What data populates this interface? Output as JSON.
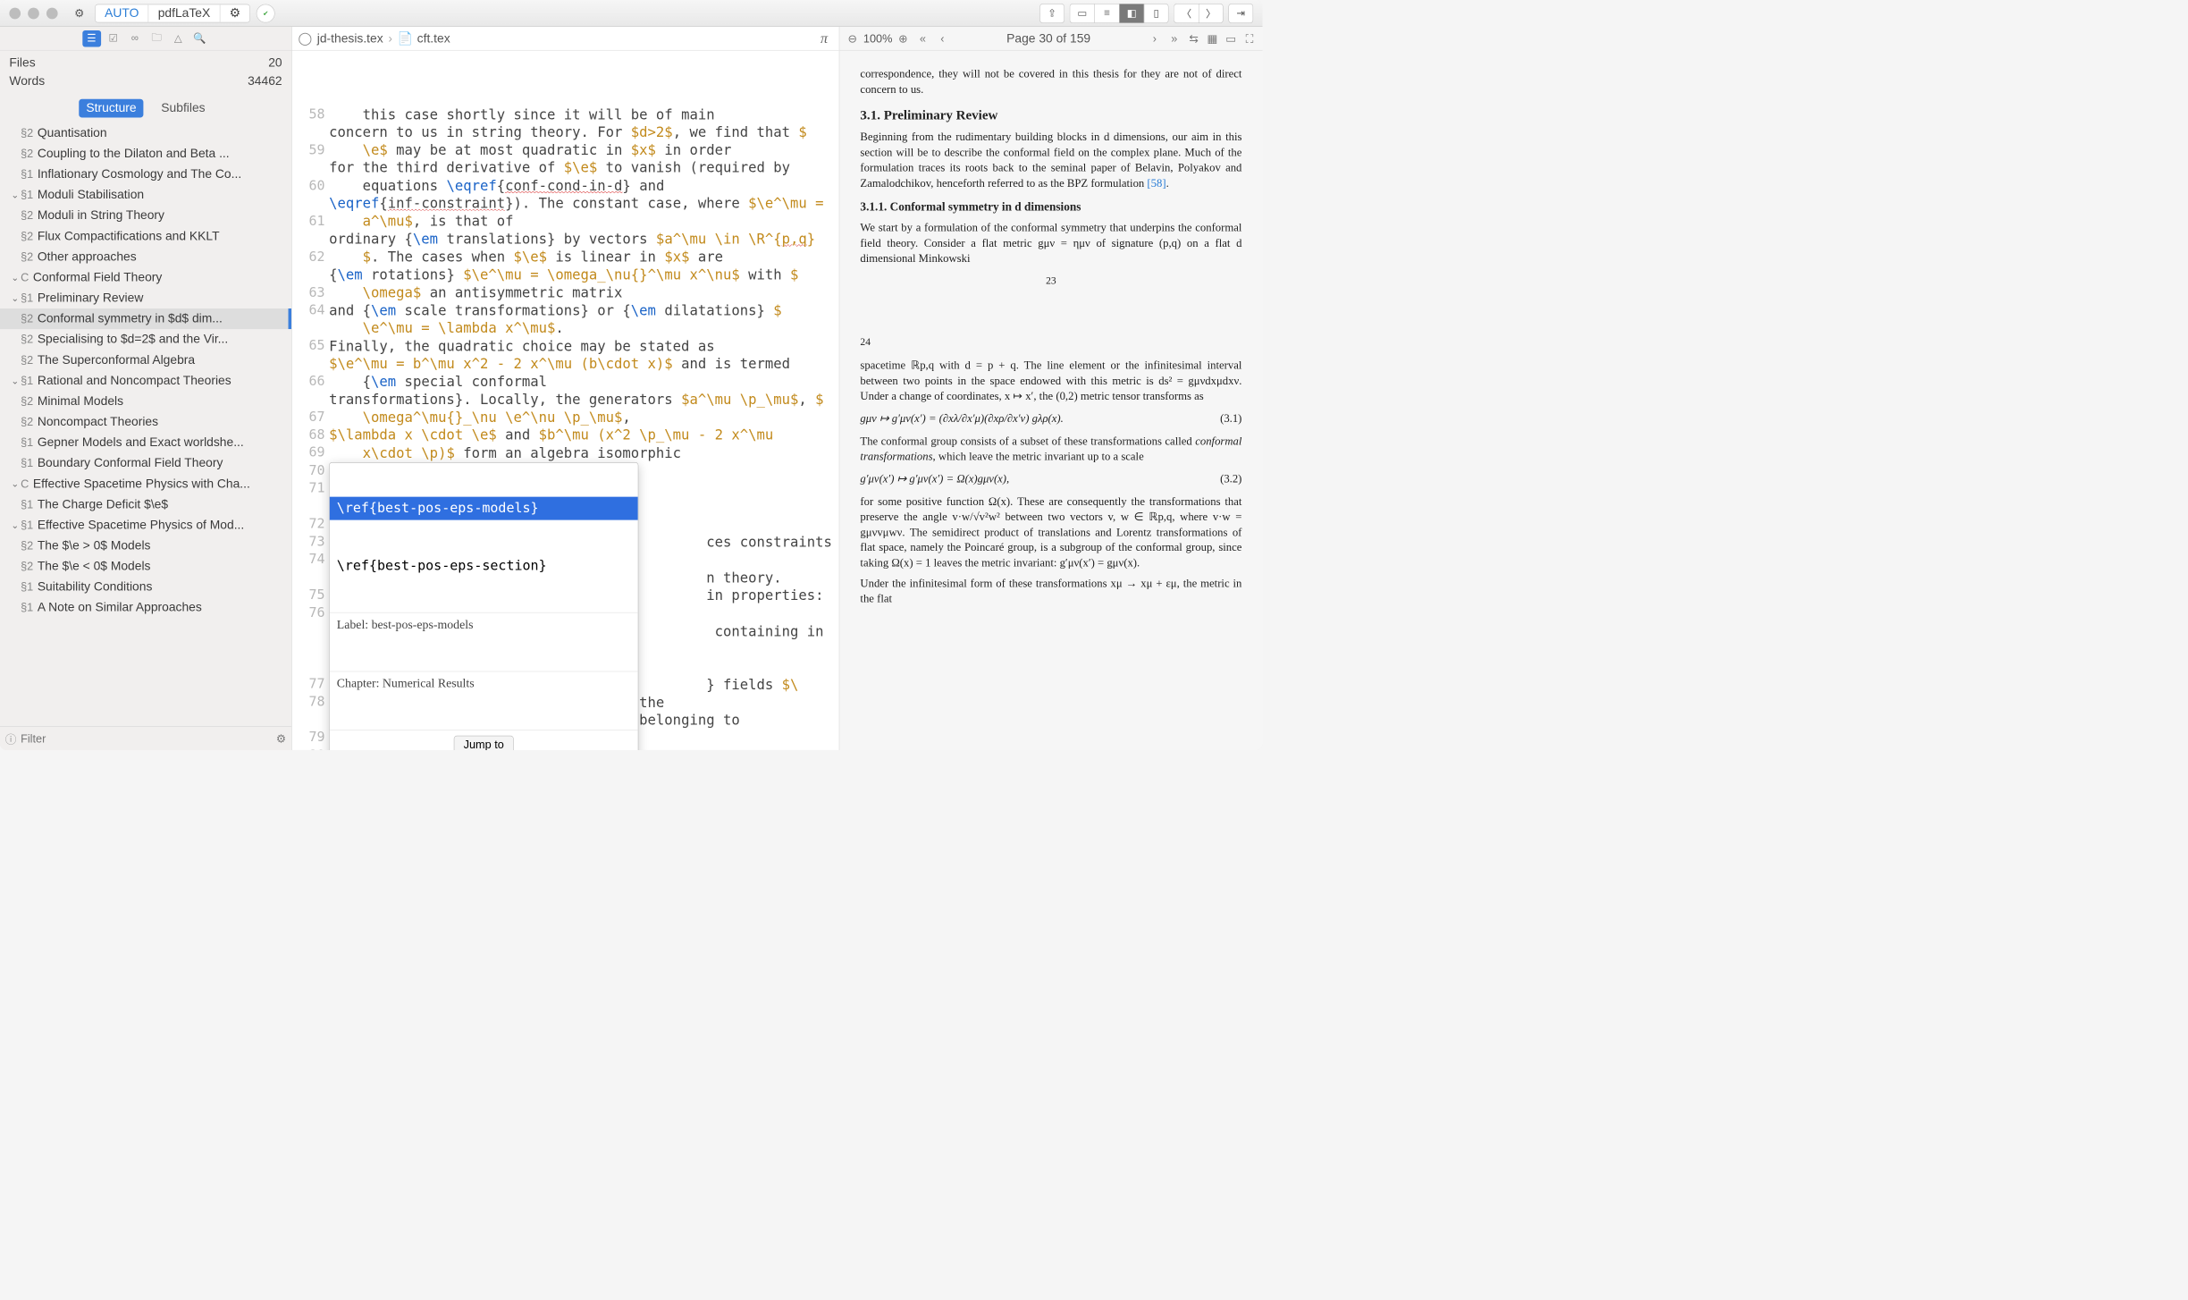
{
  "toolbar": {
    "auto": "AUTO",
    "engine": "pdfLaTeX"
  },
  "sidebar": {
    "stats": {
      "files_label": "Files",
      "files": "20",
      "words_label": "Words",
      "words": "34462"
    },
    "tabs": {
      "structure": "Structure",
      "subfiles": "Subfiles"
    },
    "items": [
      {
        "num": "§2",
        "label": "Quantisation",
        "indent": 2
      },
      {
        "num": "§2",
        "label": "Coupling to the Dilaton and Beta ...",
        "indent": 1
      },
      {
        "num": "§1",
        "label": "Inflationary Cosmology and The Co...",
        "indent": 1
      },
      {
        "num": "§1",
        "label": "Moduli Stabilisation",
        "indent": 1,
        "disclose": true
      },
      {
        "num": "§2",
        "label": "Moduli in String Theory",
        "indent": 2
      },
      {
        "num": "§2",
        "label": "Flux Compactifications and KKLT",
        "indent": 2
      },
      {
        "num": "§2",
        "label": "Other approaches",
        "indent": 2
      },
      {
        "num": "C",
        "label": "Conformal Field Theory",
        "indent": 0,
        "disclose": true
      },
      {
        "num": "§1",
        "label": "Preliminary Review",
        "indent": 1,
        "disclose": true
      },
      {
        "num": "§2",
        "label": "Conformal symmetry in $d$ dim...",
        "indent": 2,
        "selected": true
      },
      {
        "num": "§2",
        "label": "Specialising to $d=2$ and the Vir...",
        "indent": 2
      },
      {
        "num": "§2",
        "label": "The Superconformal Algebra",
        "indent": 2
      },
      {
        "num": "§1",
        "label": "Rational and Noncompact Theories",
        "indent": 1,
        "disclose": true
      },
      {
        "num": "§2",
        "label": "Minimal Models",
        "indent": 2
      },
      {
        "num": "§2",
        "label": "Noncompact Theories",
        "indent": 2
      },
      {
        "num": "§1",
        "label": "Gepner Models and Exact worldshe...",
        "indent": 1
      },
      {
        "num": "§1",
        "label": "Boundary Conformal Field Theory",
        "indent": 1
      },
      {
        "num": "C",
        "label": "Effective Spacetime Physics with Cha...",
        "indent": 0,
        "disclose": true
      },
      {
        "num": "§1",
        "label": "The Charge Deficit $\\e$",
        "indent": 1
      },
      {
        "num": "§1",
        "label": "Effective Spacetime Physics of Mod...",
        "indent": 1,
        "disclose": true
      },
      {
        "num": "§2",
        "label": "The $\\e > 0$ Models",
        "indent": 2
      },
      {
        "num": "§2",
        "label": "The $\\e < 0$ Models",
        "indent": 2
      },
      {
        "num": "§1",
        "label": "Suitability Conditions",
        "indent": 1
      },
      {
        "num": "§1",
        "label": "A Note on Similar Approaches",
        "indent": 1
      }
    ],
    "filter_placeholder": "Filter"
  },
  "editor": {
    "breadcrumb": {
      "file1": "jd-thesis.tex",
      "file2": "cft.tex"
    },
    "popup": {
      "opt1": "\\ref{best-pos-eps-models}",
      "opt2": "\\ref{best-pos-eps-section}",
      "label": "Label: best-pos-eps-models",
      "chapter": "Chapter: Numerical Results",
      "jump": "Jump to"
    }
  },
  "preview": {
    "zoom": "100%",
    "page_label": "Page 30 of 159",
    "intro": "correspondence, they will not be covered in this thesis for they are not of direct concern to us.",
    "h_prelim": "3.1.  Preliminary Review",
    "p_prelim": "Beginning from the rudimentary building blocks in d dimensions, our aim in this section will be to describe the conformal field on the complex plane. Much of the formulation traces its roots back to the seminal paper of Belavin, Polyakov and Zamalodchikov, henceforth referred to as the BPZ formulation ",
    "cite58": "[58]",
    "h_conf": "3.1.1.  Conformal symmetry in d dimensions",
    "p_conf1": "We start by a formulation of the conformal symmetry that underpins the conformal field theory. Consider a flat metric gμν = ημν of signature (p,q) on a flat d dimensional Minkowski",
    "pg23": "23",
    "pg24": "24",
    "p_conf2": "spacetime ℝp,q with d = p + q. The line element or the infinitesimal interval between two points in the space endowed with this metric is ds² = gμνdxμdxν. Under a change of coordinates, x ↦ x′, the (0,2) metric tensor transforms as",
    "eq31": "gμν ↦ g′μν(x′) = (∂xλ/∂x′μ)(∂xρ/∂x′ν) gλρ(x).",
    "eq31n": "(3.1)",
    "p_conf3_a": "The conformal group consists of a subset of these transformations called ",
    "p_conf3_b": "conformal transformations",
    "p_conf3_c": ", which leave the metric invariant up to a scale",
    "eq32": "g′μν(x′) ↦ g′μν(x′) = Ω(x)gμν(x),",
    "eq32n": "(3.2)",
    "p_conf4": "for some positive function Ω(x). These are consequently the transformations that preserve the angle v·w/√v²w² between two vectors v, w ∈ ℝp,q, where v·w = gμνvμwν. The semidirect product of translations and Lorentz transformations of flat space, namely the Poincaré group, is a subgroup of the conformal group, since taking Ω(x) = 1 leaves the metric invariant: g′μν(x′) = gμν(x).",
    "p_conf5": "Under the infinitesimal form of these transformations xμ → xμ + εμ, the metric in the flat"
  }
}
